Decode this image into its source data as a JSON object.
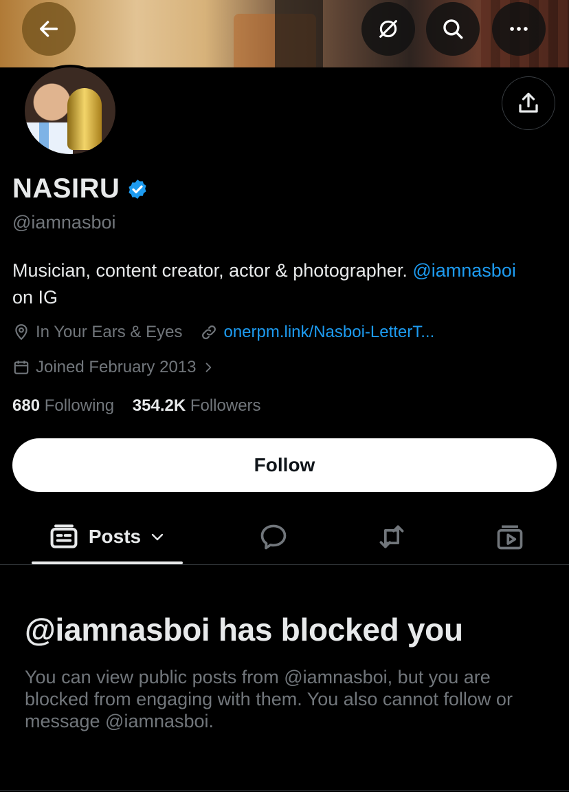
{
  "header": {
    "back_icon": "arrow-left-icon",
    "grok_icon": "slash-circle-icon",
    "search_icon": "search-icon",
    "more_icon": "more-dots-icon"
  },
  "profile": {
    "name": "NASIRU",
    "handle": "@iamnasboi",
    "bio_text": "Musician, content creator, actor & photographer.",
    "bio_mention": "@iamnasboi",
    "bio_suffix": "on IG",
    "location": "In Your Ears & Eyes",
    "website": "onerpm.link/Nasboi-LetterT...",
    "joined": "Joined February 2013",
    "following_count": "680",
    "following_label": "Following",
    "followers_count": "354.2K",
    "followers_label": "Followers"
  },
  "actions": {
    "follow_label": "Follow"
  },
  "tabs": {
    "posts_label": "Posts"
  },
  "blocked": {
    "title": "@iamnasboi has blocked you",
    "description": "You can view public posts from @iamnasboi, but you are blocked from engaging with them. You also cannot follow or message @iamnasboi."
  },
  "colors": {
    "background": "#000000",
    "accent": "#1d9bf0",
    "muted": "#71767b",
    "text": "#e7e9ea"
  }
}
